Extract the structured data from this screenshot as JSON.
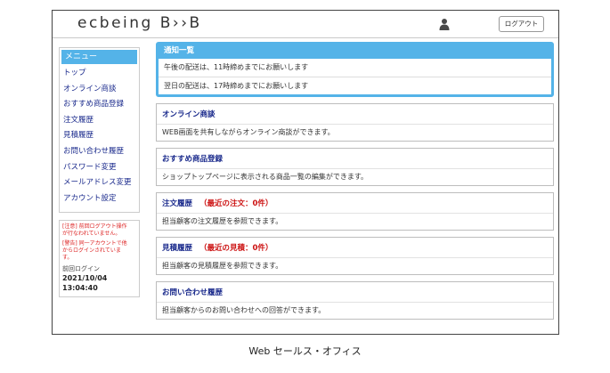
{
  "header": {
    "logo": "ecbeing B››B",
    "logout_label": "ログアウト"
  },
  "sidebar": {
    "menu_title": "メニュー",
    "items": [
      "トップ",
      "オンライン商談",
      "おすすめ商品登録",
      "注文履歴",
      "見積履歴",
      "お問い合わせ履歴",
      "パスワード変更",
      "メールアドレス変更",
      "アカウント設定"
    ],
    "notices": [
      [
        "[注意] 前回ログアウト操作",
        "が行なわれていません。"
      ],
      [
        "[警告] 同一アカウントで他",
        "からログインされていま",
        "す。"
      ]
    ],
    "last_login_label": "前回ログイン",
    "last_login_time": "2021/10/04 13:04:40"
  },
  "announcements": {
    "title": "通知一覧",
    "rows": [
      "午後の配送は、11時締めまでにお願いします",
      "翌日の配送は、17時締めまでにお願いします"
    ]
  },
  "cards": [
    {
      "title": "オンライン商談",
      "recent": "",
      "desc": "WEB画面を共有しながらオンライン商談ができます。"
    },
    {
      "title": "おすすめ商品登録",
      "recent": "",
      "desc": "ショップトップページに表示される商品一覧の編集ができます。"
    },
    {
      "title": "注文履歴",
      "recent": "（最近の注文：0件）",
      "desc": "担当顧客の注文履歴を参照できます。"
    },
    {
      "title": "見積履歴",
      "recent": "（最近の見積：0件）",
      "desc": "担当顧客の見積履歴を参照できます。"
    },
    {
      "title": "お問い合わせ履歴",
      "recent": "",
      "desc": "担当顧客からのお問い合わせへの回答ができます。"
    }
  ],
  "caption": "Web セールス・オフィス",
  "colors": {
    "accent": "#54b3e8",
    "link": "#1a2a8c",
    "alert": "#cc1111"
  },
  "icons": {
    "user": "user-icon"
  }
}
